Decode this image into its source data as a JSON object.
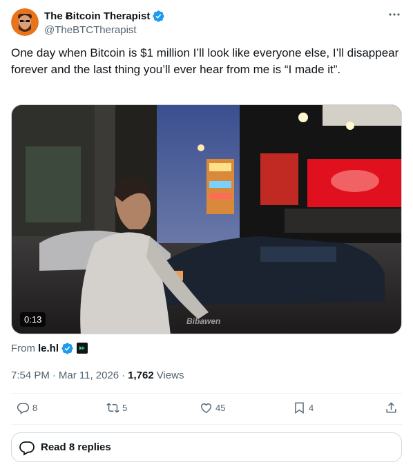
{
  "author": {
    "name": "The Ƀitcoin Therapist",
    "handle": "@TheBTCTherapist",
    "verified": true
  },
  "tweet": {
    "text": "One day when Bitcoin is $1 million I’ll look like everyone else, I’ll disappear forever and the last thing you’ll ever hear from me is “I made it”."
  },
  "media": {
    "type": "video",
    "duration": "0:13",
    "watermark": "Bibawen"
  },
  "attribution": {
    "prefix": "From",
    "handle": "le.hl"
  },
  "meta": {
    "time": "7:54 PM",
    "separator": "·",
    "date": "Mar 11, 2026",
    "views_count": "1,762",
    "views_label": "Views"
  },
  "actions": {
    "replies": "8",
    "reposts": "5",
    "likes": "45",
    "bookmarks": "4"
  },
  "read_replies": {
    "label": "Read 8 replies"
  },
  "colors": {
    "verified": "#1d9bf0",
    "text_primary": "#0f1419",
    "text_secondary": "#536471",
    "border": "#cfd9de"
  }
}
